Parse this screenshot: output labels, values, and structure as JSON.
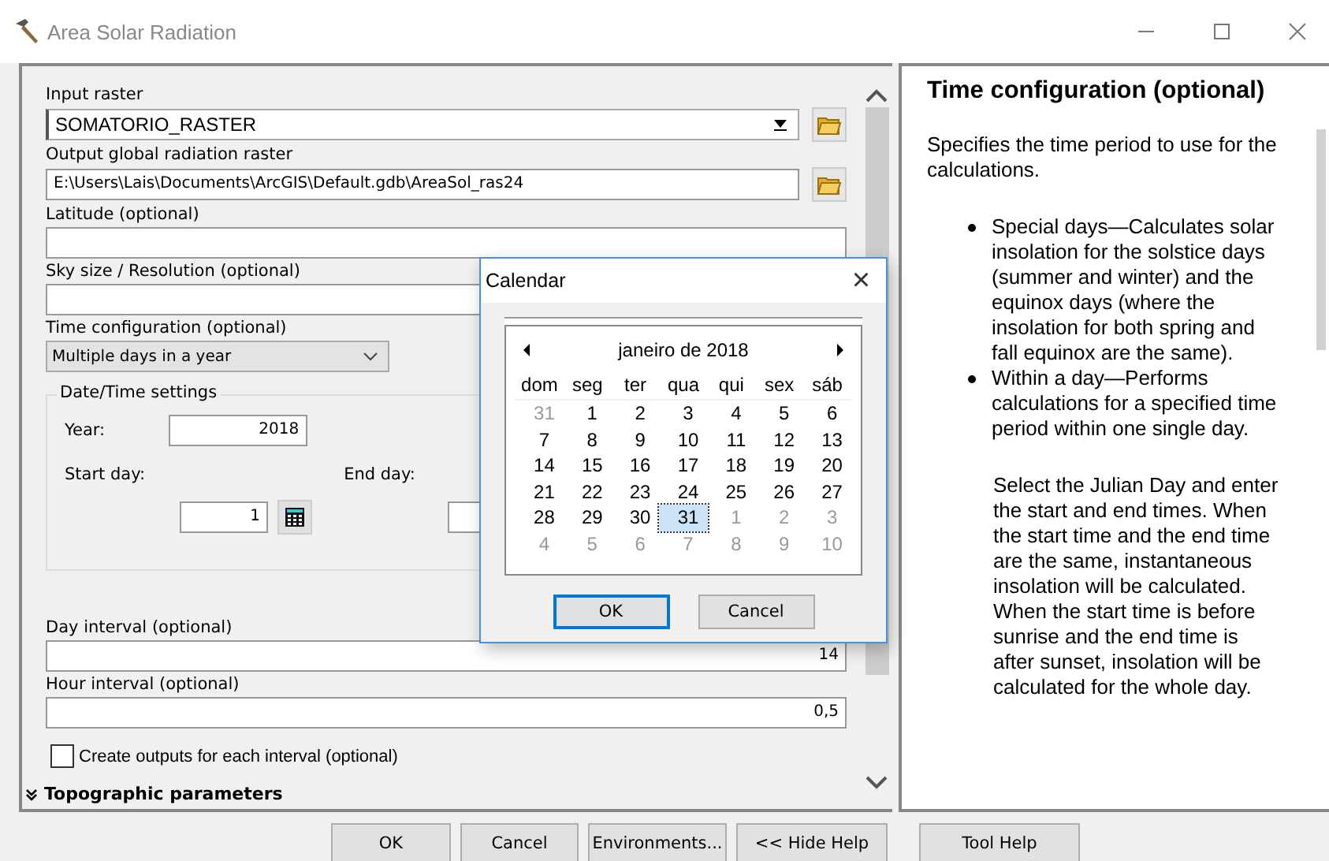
{
  "window": {
    "title": "Area Solar Radiation"
  },
  "form": {
    "input_raster": {
      "label": "Input raster",
      "value": "SOMATORIO_RASTER"
    },
    "output_raster": {
      "label": "Output global radiation raster",
      "value": "E:\\Users\\Lais\\Documents\\ArcGIS\\Default.gdb\\AreaSol_ras24"
    },
    "latitude": {
      "label": "Latitude (optional)"
    },
    "sky_size": {
      "label": "Sky size / Resolution (optional)"
    },
    "time_configuration": {
      "label": "Time configuration (optional)",
      "value": "Multiple days in a year"
    },
    "date_time_settings": {
      "title": "Date/Time settings",
      "year_label": "Year:",
      "year": "2018",
      "start_day_label": "Start day:",
      "start_day": "1",
      "end_day_label": "End day:"
    },
    "day_interval": {
      "label": "Day interval (optional)",
      "value": "14"
    },
    "hour_interval": {
      "label": "Hour interval (optional)",
      "value": "0,5"
    },
    "create_outputs": {
      "label": "Create outputs for each interval (optional)",
      "checked": false
    },
    "section": {
      "label": "Topographic parameters",
      "expanded": false
    }
  },
  "calendar": {
    "title": "Calendar",
    "close": "×",
    "month": "janeiro de 2018",
    "weekdays": [
      "dom",
      "seg",
      "ter",
      "qua",
      "qui",
      "sex",
      "sáb"
    ],
    "days": [
      {
        "label": "31",
        "other_month": true,
        "selected": false
      },
      {
        "label": "1",
        "other_month": false,
        "selected": false
      },
      {
        "label": "2",
        "other_month": false,
        "selected": false
      },
      {
        "label": "3",
        "other_month": false,
        "selected": false
      },
      {
        "label": "4",
        "other_month": false,
        "selected": false
      },
      {
        "label": "5",
        "other_month": false,
        "selected": false
      },
      {
        "label": "6",
        "other_month": false,
        "selected": false
      },
      {
        "label": "7",
        "other_month": false,
        "selected": false
      },
      {
        "label": "8",
        "other_month": false,
        "selected": false
      },
      {
        "label": "9",
        "other_month": false,
        "selected": false
      },
      {
        "label": "10",
        "other_month": false,
        "selected": false
      },
      {
        "label": "11",
        "other_month": false,
        "selected": false
      },
      {
        "label": "12",
        "other_month": false,
        "selected": false
      },
      {
        "label": "13",
        "other_month": false,
        "selected": false
      },
      {
        "label": "14",
        "other_month": false,
        "selected": false
      },
      {
        "label": "15",
        "other_month": false,
        "selected": false
      },
      {
        "label": "16",
        "other_month": false,
        "selected": false
      },
      {
        "label": "17",
        "other_month": false,
        "selected": false
      },
      {
        "label": "18",
        "other_month": false,
        "selected": false
      },
      {
        "label": "19",
        "other_month": false,
        "selected": false
      },
      {
        "label": "20",
        "other_month": false,
        "selected": false
      },
      {
        "label": "21",
        "other_month": false,
        "selected": false
      },
      {
        "label": "22",
        "other_month": false,
        "selected": false
      },
      {
        "label": "23",
        "other_month": false,
        "selected": false
      },
      {
        "label": "24",
        "other_month": false,
        "selected": false
      },
      {
        "label": "25",
        "other_month": false,
        "selected": false
      },
      {
        "label": "26",
        "other_month": false,
        "selected": false
      },
      {
        "label": "27",
        "other_month": false,
        "selected": false
      },
      {
        "label": "28",
        "other_month": false,
        "selected": false
      },
      {
        "label": "29",
        "other_month": false,
        "selected": false
      },
      {
        "label": "30",
        "other_month": false,
        "selected": false
      },
      {
        "label": "31",
        "other_month": false,
        "selected": true
      },
      {
        "label": "1",
        "other_month": true,
        "selected": false
      },
      {
        "label": "2",
        "other_month": true,
        "selected": false
      },
      {
        "label": "3",
        "other_month": true,
        "selected": false
      },
      {
        "label": "4",
        "other_month": true,
        "selected": false
      },
      {
        "label": "5",
        "other_month": true,
        "selected": false
      },
      {
        "label": "6",
        "other_month": true,
        "selected": false
      },
      {
        "label": "7",
        "other_month": true,
        "selected": false
      },
      {
        "label": "8",
        "other_month": true,
        "selected": false
      },
      {
        "label": "9",
        "other_month": true,
        "selected": false
      },
      {
        "label": "10",
        "other_month": true,
        "selected": false
      }
    ],
    "buttons": [
      {
        "label": "OK",
        "default": true
      },
      {
        "label": "Cancel",
        "default": false
      }
    ]
  },
  "help": {
    "title": "Time configuration (optional)",
    "intro": "Specifies the time period to use for the calculations.",
    "bullets": [
      "Special days—Calculates solar insolation for the solstice days (summer and winter) and the equinox days (where the insolation for both spring and fall equinox are the same).",
      "Within a day—Performs calculations for a specified time period within one single day."
    ],
    "paragraph": "Select the Julian Day and enter the start and end times. When the start time and the end time are the same, instantaneous insolation will be calculated. When the start time is before sunrise and the end time is after sunset, insolation will be calculated for the whole day."
  },
  "buttons": [
    "OK",
    "Cancel",
    "Environments...",
    "<< Hide Help",
    "Tool Help"
  ]
}
